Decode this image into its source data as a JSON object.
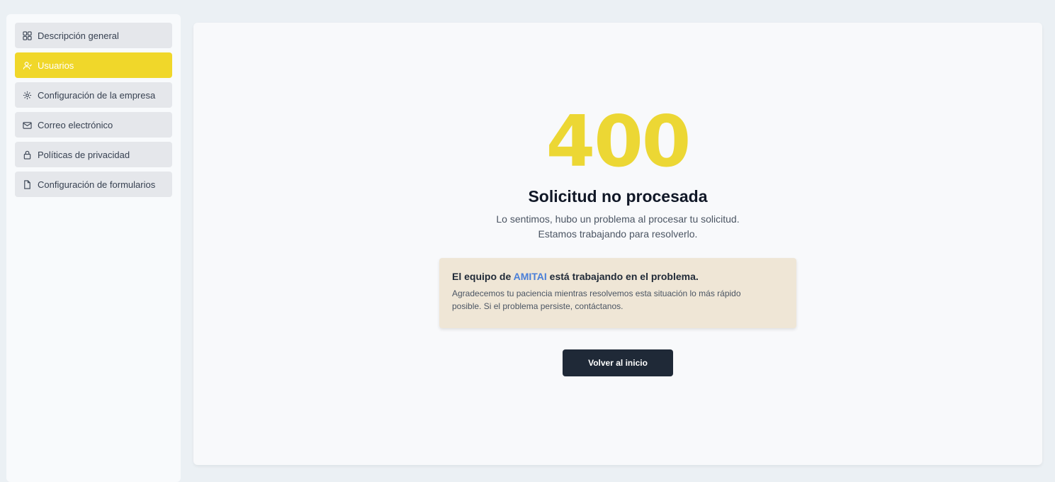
{
  "sidebar": {
    "items": [
      {
        "label": "Descripción general",
        "icon": "grid-icon",
        "active": false
      },
      {
        "label": "Usuarios",
        "icon": "user-icon",
        "active": true
      },
      {
        "label": "Configuración de la empresa",
        "icon": "gear-icon",
        "active": false
      },
      {
        "label": "Correo electrónico",
        "icon": "mail-icon",
        "active": false
      },
      {
        "label": "Políticas de privacidad",
        "icon": "lock-icon",
        "active": false
      },
      {
        "label": "Configuración de formularios",
        "icon": "file-icon",
        "active": false
      }
    ]
  },
  "error": {
    "code": "400",
    "title": "Solicitud no procesada",
    "subtitle_line1": "Lo sentimos, hubo un problema al procesar tu solicitud.",
    "subtitle_line2": "Estamos trabajando para resolverlo."
  },
  "notice": {
    "title_prefix": "El equipo de ",
    "brand": "AMITAI",
    "title_suffix": " está trabajando en el problema.",
    "body_line1": "Agradecemos tu paciencia mientras resolvemos esta situación lo más rápido",
    "body_line2": "posible. Si el problema persiste, contáctanos."
  },
  "actions": {
    "home_button": "Volver al inicio"
  },
  "colors": {
    "accent_yellow": "#f0d72a",
    "code_yellow": "#ecd734",
    "brand_blue": "#4a7fd8",
    "button_dark": "#1f2937",
    "notice_bg": "#efe6d6"
  }
}
